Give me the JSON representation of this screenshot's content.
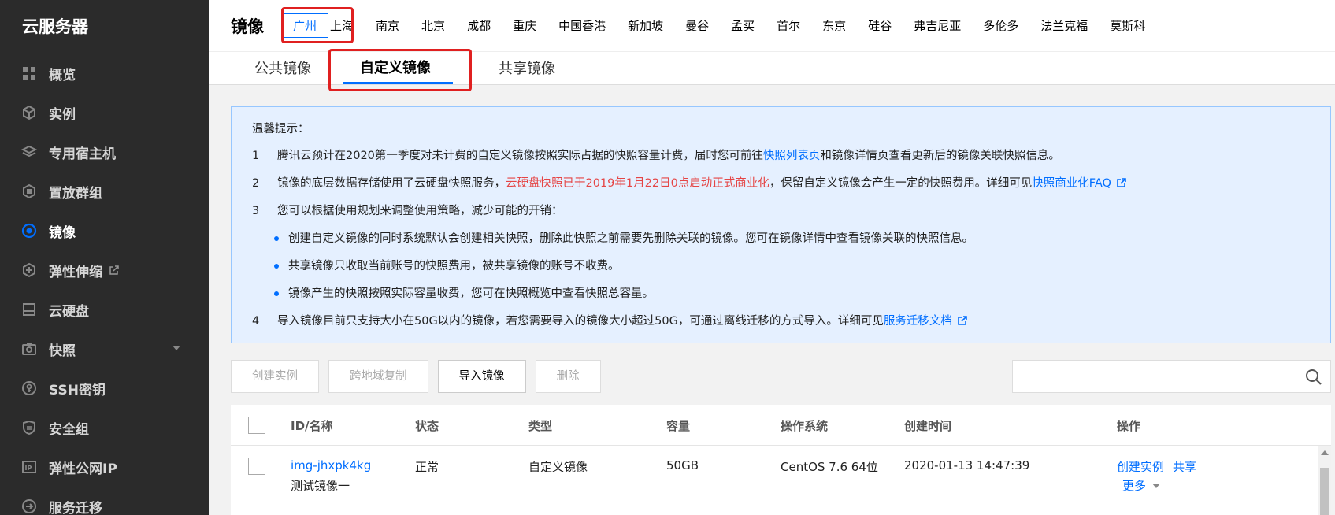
{
  "sidebar": {
    "brand": "云服务器",
    "items": [
      {
        "label": "概览",
        "icon": "grid-icon"
      },
      {
        "label": "实例",
        "icon": "cube-icon"
      },
      {
        "label": "专用宿主机",
        "icon": "layers-icon"
      },
      {
        "label": "置放群组",
        "icon": "group-icon"
      },
      {
        "label": "镜像",
        "icon": "target-icon",
        "active": true
      },
      {
        "label": "弹性伸缩",
        "icon": "scale-icon",
        "external": true
      },
      {
        "label": "云硬盘",
        "icon": "disk-icon"
      },
      {
        "label": "快照",
        "icon": "camera-icon",
        "expandable": true
      },
      {
        "label": "SSH密钥",
        "icon": "key-icon"
      },
      {
        "label": "安全组",
        "icon": "shield-icon"
      },
      {
        "label": "弹性公网IP",
        "icon": "ip-icon"
      },
      {
        "label": "服务迁移",
        "icon": "migrate-icon"
      }
    ]
  },
  "header": {
    "title": "镜像",
    "regions": [
      "广州",
      "上海",
      "南京",
      "北京",
      "成都",
      "重庆",
      "中国香港",
      "新加坡",
      "曼谷",
      "孟买",
      "首尔",
      "东京",
      "硅谷",
      "弗吉尼亚",
      "多伦多",
      "法兰克福",
      "莫斯科"
    ],
    "selected_region": "广州"
  },
  "tabs": [
    "公共镜像",
    "自定义镜像",
    "共享镜像"
  ],
  "notice": {
    "title": "温馨提示：",
    "item1_num": "1",
    "item1_pre": "腾讯云预计在2020第一季度对未计费的自定义镜像按照实际占据的快照容量计费，届时您可前往",
    "item1_link": "快照列表页",
    "item1_post": "和镜像详情页查看更新后的镜像关联快照信息。",
    "item2_num": "2",
    "item2_pre": "镜像的底层数据存储使用了云硬盘快照服务，",
    "item2_warn": "云硬盘快照已于2019年1月22日0点启动正式商业化",
    "item2_mid": "，保留自定义镜像会产生一定的快照费用。详细可见",
    "item2_link": "快照商业化FAQ",
    "item3_num": "3",
    "item3_text": "您可以根据使用规划来调整使用策略，减少可能的开销：",
    "item3_subs": [
      "创建自定义镜像的同时系统默认会创建相关快照，删除此快照之前需要先删除关联的镜像。您可在镜像详情中查看镜像关联的快照信息。",
      "共享镜像只收取当前账号的快照费用，被共享镜像的账号不收费。",
      "镜像产生的快照按照实际容量收费，您可在快照概览中查看快照总容量。"
    ],
    "item4_num": "4",
    "item4_pre": "导入镜像目前只支持大小在50G以内的镜像，若您需要导入的镜像大小超过50G，可通过离线迁移的方式导入。详细可见",
    "item4_link": "服务迁移文档"
  },
  "toolbar": {
    "create_instance": "创建实例",
    "cross_region_copy": "跨地域复制",
    "import_image": "导入镜像",
    "delete": "删除",
    "search_placeholder": ""
  },
  "table": {
    "columns": [
      "ID/名称",
      "状态",
      "类型",
      "容量",
      "操作系统",
      "创建时间",
      "操作"
    ],
    "rows": [
      {
        "id": "img-jhxpk4kg",
        "name": "测试镜像一",
        "status": "正常",
        "type": "自定义镜像",
        "size": "50GB",
        "os": "CentOS 7.6 64位",
        "created": "2020-01-13 14:47:39",
        "op_create": "创建实例",
        "op_share": "共享",
        "op_more": "更多"
      }
    ]
  },
  "colors": {
    "accent": "#006eff",
    "warning": "#e54545",
    "highlight": "#e02020",
    "sidebar": "#2b2b2b"
  }
}
